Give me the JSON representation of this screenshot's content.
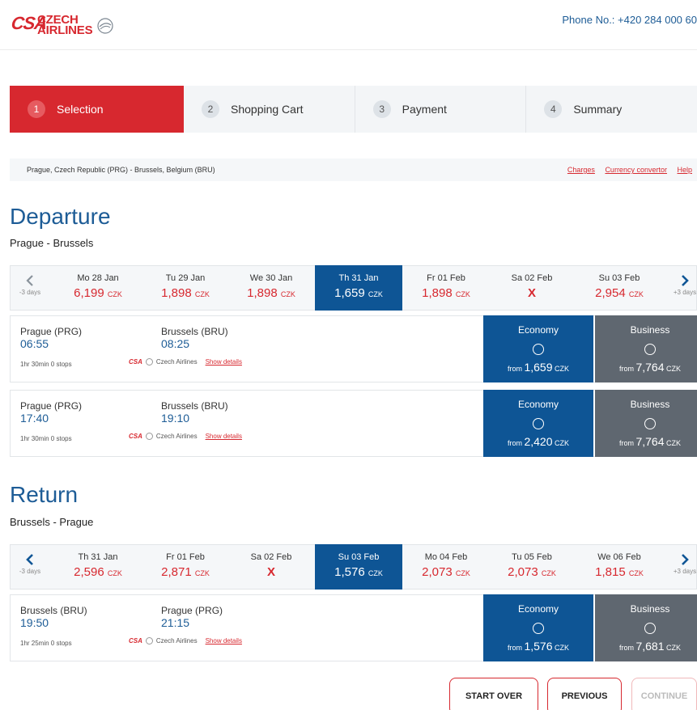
{
  "header": {
    "logo_csa": "CSA",
    "logo_line1": "CZECH",
    "logo_line2": "AIRLINES",
    "phone": "Phone No.: +420 284 000 60"
  },
  "steps": [
    {
      "num": "1",
      "label": "Selection",
      "active": true
    },
    {
      "num": "2",
      "label": "Shopping Cart"
    },
    {
      "num": "3",
      "label": "Payment"
    },
    {
      "num": "4",
      "label": "Summary"
    }
  ],
  "routebar": {
    "route": "Prague, Czech Republic (PRG) - Brussels, Belgium (BRU)",
    "links": [
      "Charges",
      "Currency convertor",
      "Help"
    ]
  },
  "departure": {
    "title": "Departure",
    "subtitle": "Prague - Brussels",
    "prev_label": "-3 days",
    "next_label": "+3 days",
    "days": [
      {
        "date": "Mo 28 Jan",
        "price": "6,199",
        "cur": "CZK"
      },
      {
        "date": "Tu 29 Jan",
        "price": "1,898",
        "cur": "CZK"
      },
      {
        "date": "We 30 Jan",
        "price": "1,898",
        "cur": "CZK"
      },
      {
        "date": "Th 31 Jan",
        "price": "1,659",
        "cur": "CZK",
        "selected": true
      },
      {
        "date": "Fr 01 Feb",
        "price": "1,898",
        "cur": "CZK"
      },
      {
        "date": "Sa 02 Feb",
        "price": "X",
        "cur": ""
      },
      {
        "date": "Su 03 Feb",
        "price": "2,954",
        "cur": "CZK"
      }
    ],
    "flights": [
      {
        "from_city": "Prague (PRG)",
        "from_time": "06:55",
        "to_city": "Brussels (BRU)",
        "to_time": "08:25",
        "duration": "1hr 30min  0 stops",
        "airline": "Czech Airlines",
        "details": "Show details",
        "eco_label": "Economy",
        "eco_from": "from",
        "eco_price": "1,659",
        "eco_cur": "CZK",
        "bus_label": "Business",
        "bus_from": "from",
        "bus_price": "7,764",
        "bus_cur": "CZK"
      },
      {
        "from_city": "Prague (PRG)",
        "from_time": "17:40",
        "to_city": "Brussels (BRU)",
        "to_time": "19:10",
        "duration": "1hr 30min  0 stops",
        "airline": "Czech Airlines",
        "details": "Show details",
        "eco_label": "Economy",
        "eco_from": "from",
        "eco_price": "2,420",
        "eco_cur": "CZK",
        "bus_label": "Business",
        "bus_from": "from",
        "bus_price": "7,764",
        "bus_cur": "CZK"
      }
    ]
  },
  "return": {
    "title": "Return",
    "subtitle": "Brussels - Prague",
    "prev_label": "-3 days",
    "next_label": "+3 days",
    "days": [
      {
        "date": "Th 31 Jan",
        "price": "2,596",
        "cur": "CZK"
      },
      {
        "date": "Fr 01 Feb",
        "price": "2,871",
        "cur": "CZK"
      },
      {
        "date": "Sa 02 Feb",
        "price": "X",
        "cur": ""
      },
      {
        "date": "Su 03 Feb",
        "price": "1,576",
        "cur": "CZK",
        "selected": true
      },
      {
        "date": "Mo 04 Feb",
        "price": "2,073",
        "cur": "CZK"
      },
      {
        "date": "Tu 05 Feb",
        "price": "2,073",
        "cur": "CZK"
      },
      {
        "date": "We 06 Feb",
        "price": "1,815",
        "cur": "CZK"
      }
    ],
    "flights": [
      {
        "from_city": "Brussels (BRU)",
        "from_time": "19:50",
        "to_city": "Prague (PRG)",
        "to_time": "21:15",
        "duration": "1hr 25min  0 stops",
        "airline": "Czech Airlines",
        "details": "Show details",
        "eco_label": "Economy",
        "eco_from": "from",
        "eco_price": "1,576",
        "eco_cur": "CZK",
        "bus_label": "Business",
        "bus_from": "from",
        "bus_price": "7,681",
        "bus_cur": "CZK"
      }
    ]
  },
  "buttons": {
    "start_over": "START OVER",
    "previous": "PREVIOUS",
    "continue": "CONTINUE"
  },
  "colors": {
    "brand_red": "#d7282f",
    "brand_blue": "#0e5595",
    "business_gray": "#5f6770"
  }
}
